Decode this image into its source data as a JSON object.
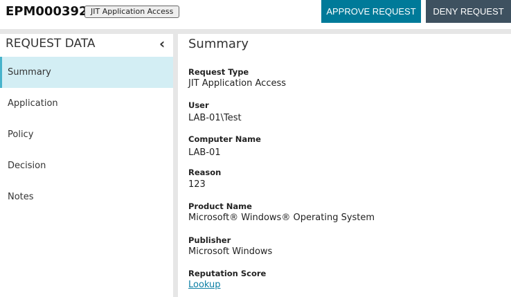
{
  "header": {
    "title": "EPM000392",
    "badge": "JIT Application Access",
    "approve": "APPROVE REQUEST",
    "deny": "DENY REQUEST"
  },
  "sidebar": {
    "heading": "REQUEST DATA",
    "items": [
      "Summary",
      "Application",
      "Policy",
      "Decision",
      "Notes"
    ]
  },
  "main": {
    "heading": "Summary",
    "fields": [
      {
        "label": "Request Type",
        "value": "JIT Application Access"
      },
      {
        "label": "User",
        "value": "LAB-01\\Test"
      },
      {
        "label": "Computer Name",
        "value": "LAB-01"
      },
      {
        "label": "Reason",
        "value": "123"
      },
      {
        "label": "Product Name",
        "value": "Microsoft® Windows® Operating System"
      },
      {
        "label": "Publisher",
        "value": "Microsoft Windows"
      },
      {
        "label": "Reputation Score",
        "value": "Lookup"
      }
    ]
  }
}
